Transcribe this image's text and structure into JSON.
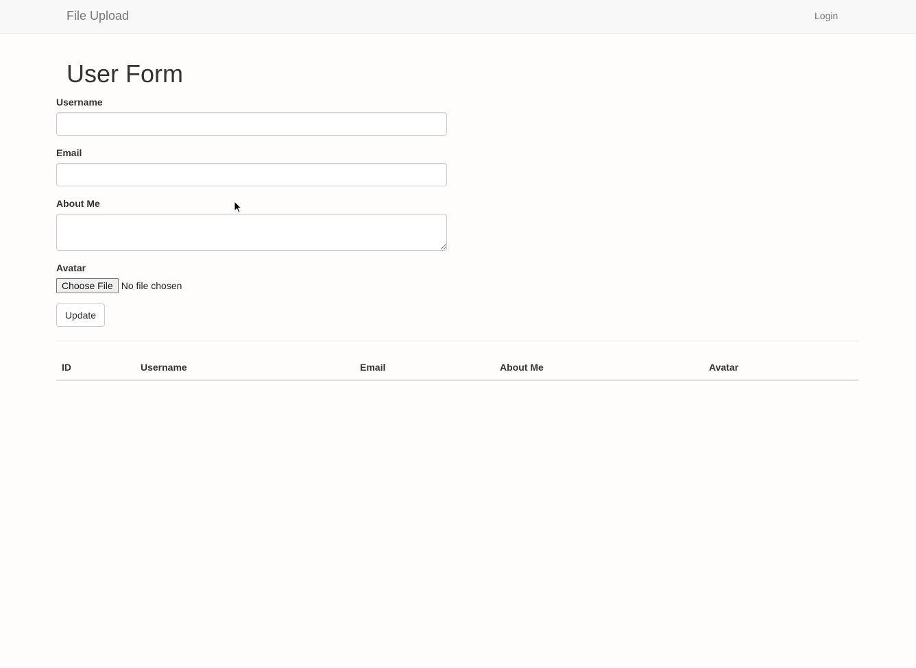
{
  "navbar": {
    "brand": "File Upload",
    "login": "Login"
  },
  "form": {
    "title": "User Form",
    "username_label": "Username",
    "username_value": "",
    "email_label": "Email",
    "email_value": "",
    "about_label": "About Me",
    "about_value": "",
    "avatar_label": "Avatar",
    "file_button": "Choose File",
    "file_status": "No file chosen",
    "submit": "Update"
  },
  "table": {
    "headers": [
      "ID",
      "Username",
      "Email",
      "About Me",
      "Avatar"
    ],
    "rows": []
  }
}
